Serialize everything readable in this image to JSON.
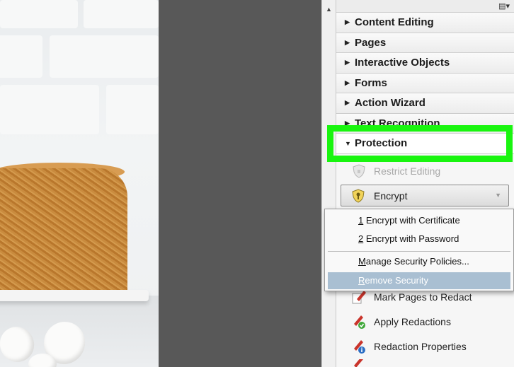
{
  "panel": {
    "menu_icon": "panel-options-icon",
    "sections": [
      {
        "label": "Content Editing"
      },
      {
        "label": "Pages"
      },
      {
        "label": "Interactive Objects"
      },
      {
        "label": "Forms"
      },
      {
        "label": "Action Wizard"
      },
      {
        "label": "Text Recognition"
      }
    ],
    "protection": {
      "label": "Protection",
      "expanded": true
    }
  },
  "tools": {
    "restrict_editing": "Restrict Editing",
    "encrypt": "Encrypt",
    "mark_pages": "Mark Pages to Redact",
    "apply_redactions": "Apply Redactions",
    "redaction_properties": "Redaction Properties"
  },
  "encrypt_menu": {
    "cert_num": "1",
    "cert_label": " Encrypt with Certificate",
    "pwd_num": "2",
    "pwd_label": " Encrypt with Password",
    "manage_u": "M",
    "manage_label": "anage Security Policies...",
    "remove_u": "R",
    "remove_label": "emove Security"
  },
  "colors": {
    "highlight": "#19f50f",
    "selected_item": "#a9bfd2"
  }
}
